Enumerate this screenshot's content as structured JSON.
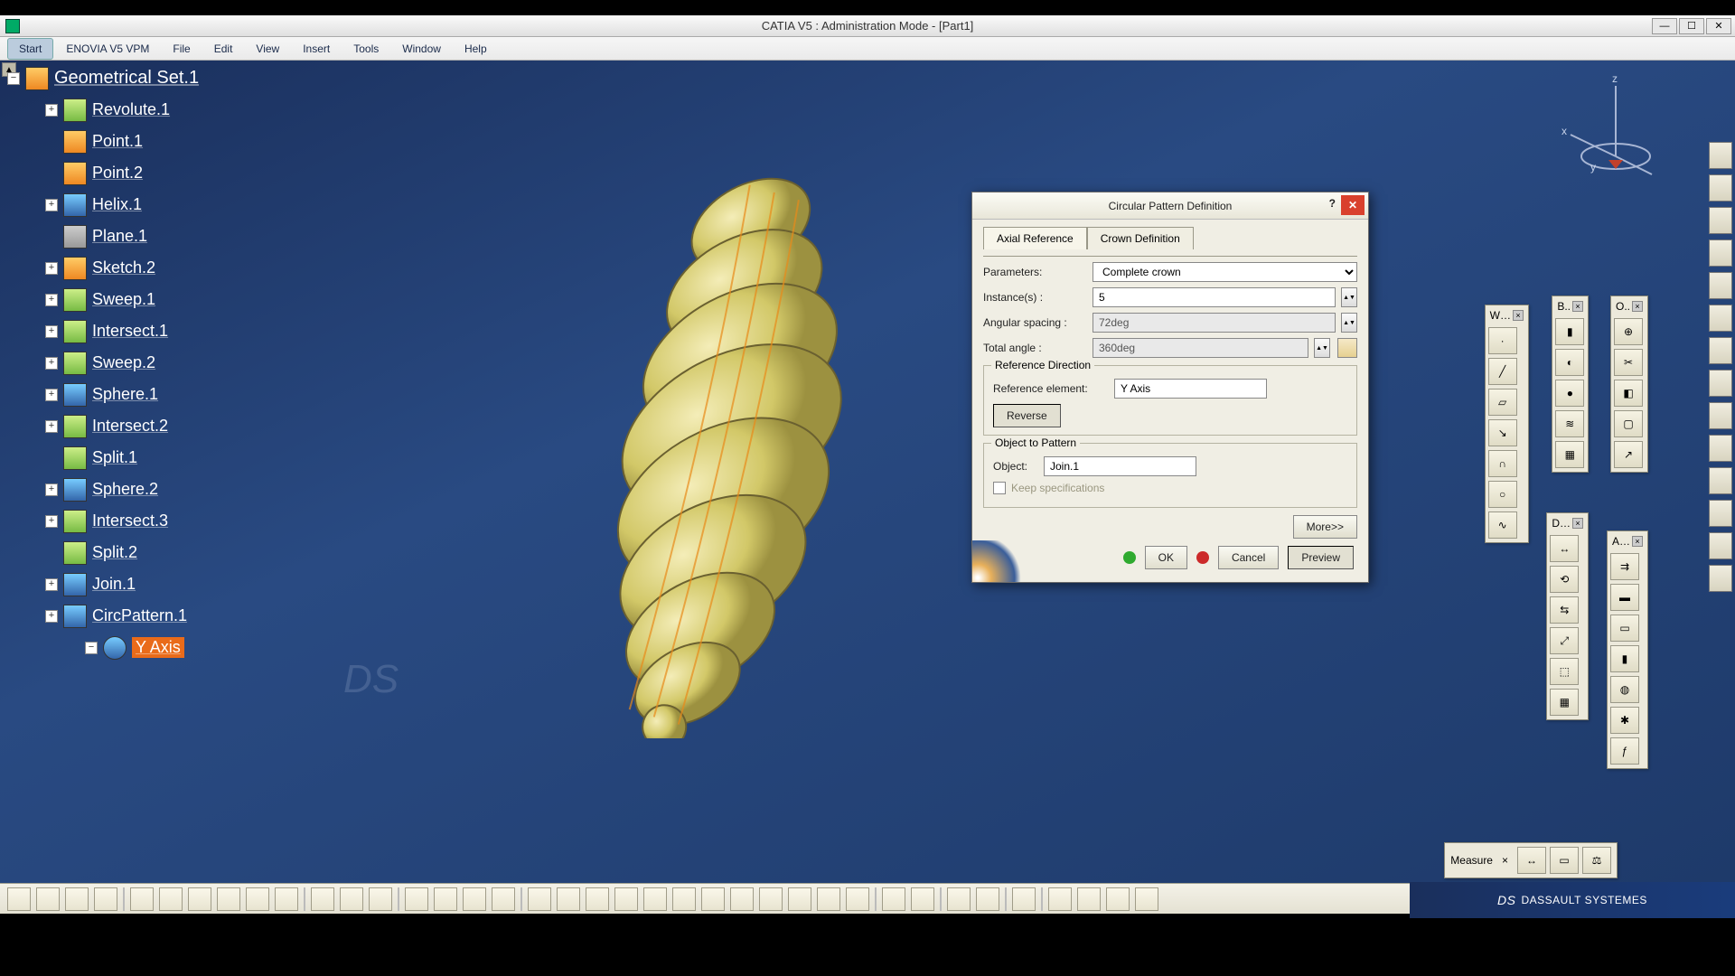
{
  "title": "CATIA V5 : Administration Mode - [Part1]",
  "menu": [
    "Start",
    "ENOVIA V5 VPM",
    "File",
    "Edit",
    "View",
    "Insert",
    "Tools",
    "Window",
    "Help"
  ],
  "tree_root": "Geometrical Set.1",
  "tree": [
    {
      "label": "Revolute.1",
      "icon": "green",
      "expand": true
    },
    {
      "label": "Point.1",
      "icon": "orange",
      "expand": false
    },
    {
      "label": "Point.2",
      "icon": "orange",
      "expand": false
    },
    {
      "label": "Helix.1",
      "icon": "blue",
      "expand": true
    },
    {
      "label": "Plane.1",
      "icon": "gray",
      "expand": false
    },
    {
      "label": "Sketch.2",
      "icon": "orange",
      "expand": true
    },
    {
      "label": "Sweep.1",
      "icon": "green",
      "expand": true
    },
    {
      "label": "Intersect.1",
      "icon": "green",
      "expand": true
    },
    {
      "label": "Sweep.2",
      "icon": "green",
      "expand": true
    },
    {
      "label": "Sphere.1",
      "icon": "blue",
      "expand": true
    },
    {
      "label": "Intersect.2",
      "icon": "green",
      "expand": true
    },
    {
      "label": "Split.1",
      "icon": "green",
      "expand": false
    },
    {
      "label": "Sphere.2",
      "icon": "blue",
      "expand": true
    },
    {
      "label": "Intersect.3",
      "icon": "green",
      "expand": true
    },
    {
      "label": "Split.2",
      "icon": "green",
      "expand": false
    },
    {
      "label": "Join.1",
      "icon": "blue",
      "expand": true
    },
    {
      "label": "CircPattern.1",
      "icon": "blue",
      "expand": true
    }
  ],
  "tree_axis": "Y Axis",
  "dialog": {
    "title": "Circular Pattern Definition",
    "tabs": [
      "Axial Reference",
      "Crown Definition"
    ],
    "parameters_label": "Parameters:",
    "parameters_value": "Complete crown",
    "instances_label": "Instance(s) :",
    "instances_value": "5",
    "angular_label": "Angular spacing :",
    "angular_value": "72deg",
    "total_label": "Total angle :",
    "total_value": "360deg",
    "refdir_title": "Reference Direction",
    "refelem_label": "Reference element:",
    "refelem_value": "Y Axis",
    "reverse": "Reverse",
    "obj_title": "Object to Pattern",
    "obj_label": "Object:",
    "obj_value": "Join.1",
    "keep_label": "Keep specifications",
    "more": "More>>",
    "ok": "OK",
    "cancel": "Cancel",
    "preview": "Preview"
  },
  "toolcols": {
    "w": "W…",
    "b": "B..",
    "o": "O..",
    "d": "D…",
    "a": "A…",
    "m": "Measure"
  },
  "compass_axes": {
    "x": "x",
    "y": "y",
    "z": "z"
  },
  "brand": "DASSAULT SYSTEMES"
}
